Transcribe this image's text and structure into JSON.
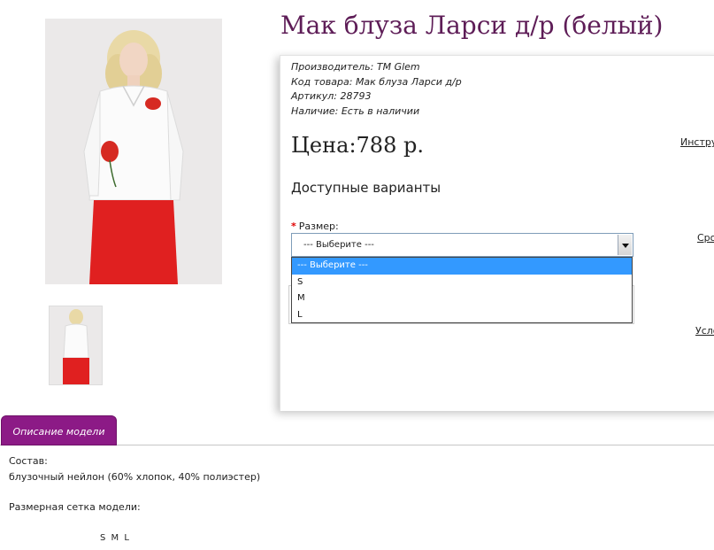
{
  "product": {
    "title": "Мак блуза Ларси д/р (белый)",
    "images": {
      "main_alt": "woman-in-white-blouse-with-poppy-print-and-red-skirt",
      "thumb_alt": "thumbnail-back-view"
    }
  },
  "meta": {
    "manufacturer_label": "Производитель:",
    "manufacturer_value": "ТМ Glem",
    "code_label": "Код товара:",
    "code_value": "Мак блуза Ларси д/р",
    "article_label": "Артикул:",
    "article_value": "28793",
    "availability_label": "Наличие:",
    "availability_value": "Есть в наличии"
  },
  "price": {
    "text": "Цена:788 р."
  },
  "options": {
    "heading": "Доступные варианты",
    "size_label": "Размер:",
    "required_mark": "*",
    "selected": "--- Выберите ---",
    "list": [
      "--- Выберите ---",
      "S",
      "M",
      "L"
    ]
  },
  "side_links": {
    "link1": "Инстру",
    "link2": "Сро",
    "link3": "Усло"
  },
  "tabs": {
    "description": "Описание модели"
  },
  "description": {
    "composition_label": "Состав:",
    "composition_value": "блузочный нейлон (60% хлопок, 40% полиэстер)",
    "size_grid_label": "Размерная сетка модели:",
    "sizes": "S M L"
  },
  "colors": {
    "title": "#5e1d57",
    "tab_bg": "#8c1a86",
    "dropdown_highlight": "#3399ff",
    "skirt": "#e02020",
    "poppy": "#d62a22"
  }
}
